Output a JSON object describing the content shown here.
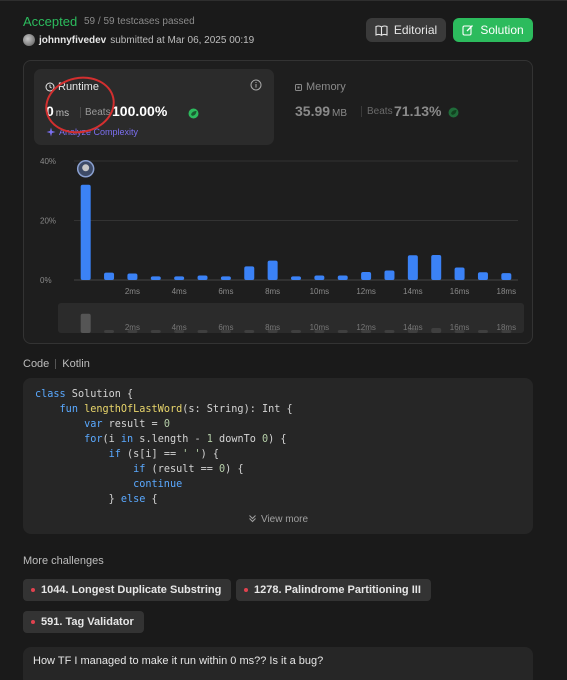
{
  "header": {
    "status": "Accepted",
    "testcases": "59 / 59 testcases passed",
    "username": "johnnyfivedev",
    "submitted": "submitted at Mar 06, 2025 00:19",
    "editorial_label": "Editorial",
    "solution_label": "Solution"
  },
  "runtime": {
    "title": "Runtime",
    "value": "0",
    "unit": "ms",
    "beats_label": "Beats",
    "beats": "100.00%",
    "analyze": "Analyze Complexity"
  },
  "memory": {
    "title": "Memory",
    "value": "35.99",
    "unit": "MB",
    "beats_label": "Beats",
    "beats": "71.13%"
  },
  "chart_data": {
    "type": "bar",
    "ylim": [
      0,
      40
    ],
    "yticks": [
      "0%",
      "20%",
      "40%"
    ],
    "x_labels": [
      "2ms",
      "4ms",
      "6ms",
      "8ms",
      "10ms",
      "12ms",
      "14ms",
      "16ms",
      "18ms"
    ],
    "values": [
      32.0,
      2.5,
      2.2,
      1.2,
      1.2,
      1.5,
      1.2,
      4.6,
      6.5,
      1.2,
      1.5,
      1.5,
      2.7,
      3.2,
      8.3,
      8.4,
      4.2,
      2.6,
      2.3
    ],
    "highlight_index": 0,
    "grid": true,
    "accent": "#3b82f6"
  },
  "code": {
    "label": "Code",
    "language": "Kotlin",
    "view_more": "View more"
  },
  "challenges": {
    "title": "More challenges",
    "items": [
      "1044. Longest Duplicate Substring",
      "1278. Palindrome Partitioning III",
      "591. Tag Validator"
    ]
  },
  "comment": {
    "text": "How TF I managed to make it run within 0 ms?? Is it a bug?"
  },
  "colors": {
    "accepted": "#2cbb5d",
    "bar": "#3b82f6",
    "annotation": "#d32f2f"
  }
}
